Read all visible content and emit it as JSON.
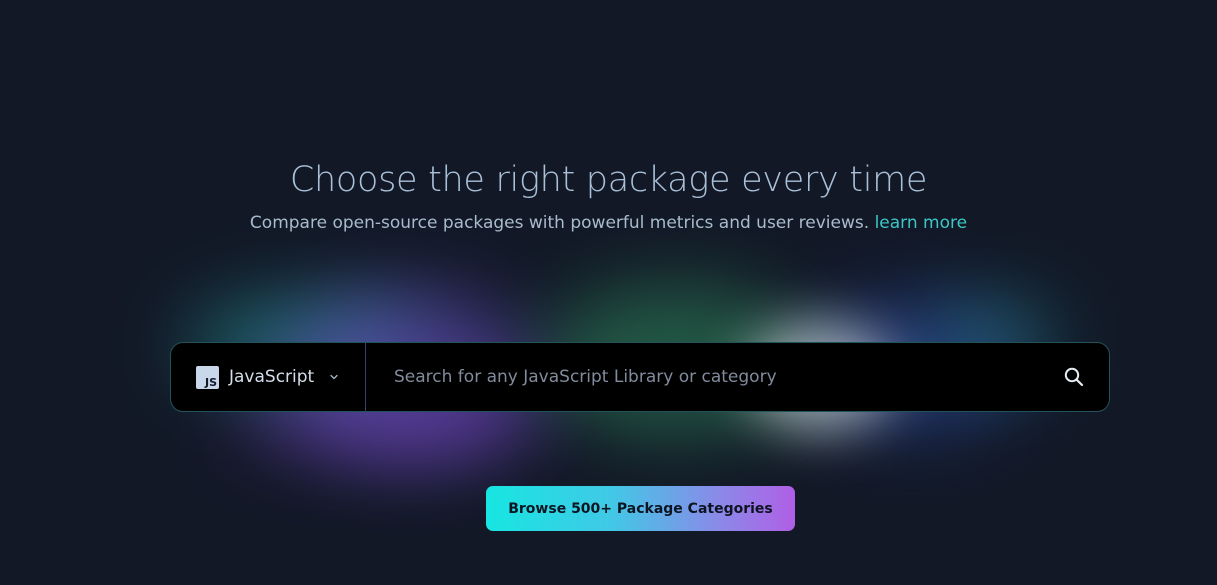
{
  "hero": {
    "title": "Choose the right package every time",
    "subtitle": "Compare open-source packages with powerful metrics and user reviews.",
    "learn_more": "learn more"
  },
  "search": {
    "language_logo_text": "JS",
    "language": "JavaScript",
    "placeholder": "Search for any JavaScript Library or category",
    "value": ""
  },
  "browse": {
    "label": "Browse 500+ Package Categories"
  },
  "icons": {
    "language": "javascript-logo-icon",
    "dropdown": "chevron-down-icon",
    "search": "search-icon"
  },
  "colors": {
    "background": "#121826",
    "accent_link": "#3cc7c7",
    "button_gradient_start": "#17e6e2",
    "button_gradient_end": "#b05fe6"
  }
}
